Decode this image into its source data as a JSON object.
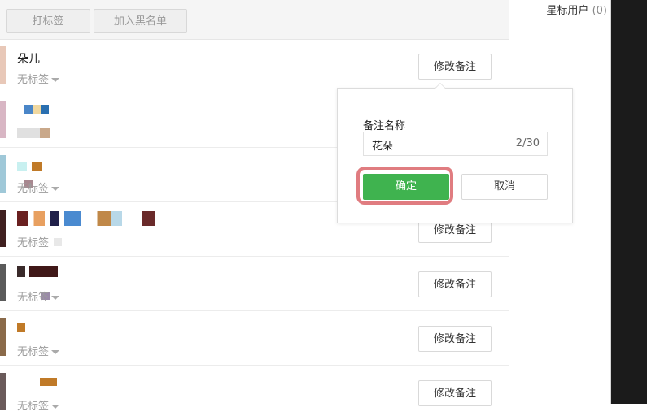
{
  "toolbar": {
    "tag_label": "打标签",
    "blacklist_label": "加入黑名单"
  },
  "contacts": [
    {
      "nick": "朵儿",
      "tag": "无标签",
      "edit_label": "修改备注"
    },
    {
      "nick": "",
      "tag": "",
      "edit_label": ""
    },
    {
      "nick": "",
      "tag": "无标签",
      "edit_label": ""
    },
    {
      "nick": "",
      "tag": "无标签",
      "edit_label": "修改备注"
    },
    {
      "nick": "",
      "tag": "无标签",
      "edit_label": "修改备注"
    },
    {
      "nick": "",
      "tag": "无标签",
      "edit_label": "修改备注"
    },
    {
      "nick": "",
      "tag": "无标签",
      "edit_label": "修改备注"
    }
  ],
  "sidebar": {
    "star_users": "星标用户",
    "star_count": "(0)"
  },
  "popup": {
    "field_label": "备注名称",
    "remark_value": "花朵",
    "char_count": "2/30",
    "confirm_label": "确定",
    "cancel_label": "取消"
  },
  "colors": {
    "accent_green": "#3fb34f",
    "highlight_ring": "#e07c80"
  }
}
